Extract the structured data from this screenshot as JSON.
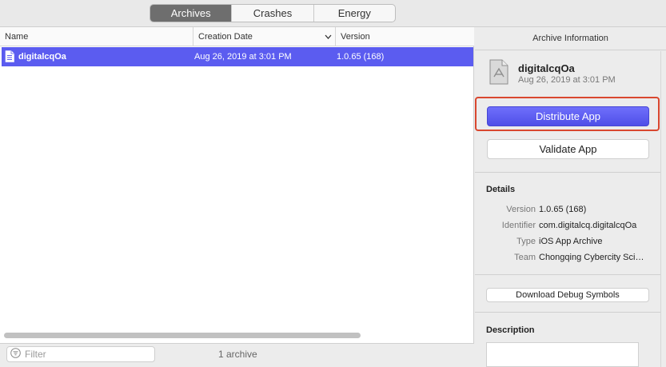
{
  "tabs": [
    {
      "label": "Archives",
      "active": true
    },
    {
      "label": "Crashes",
      "active": false
    },
    {
      "label": "Energy",
      "active": false
    }
  ],
  "table": {
    "columns": [
      "Name",
      "Creation Date",
      "Version"
    ],
    "rows": [
      {
        "name": "digitalcqOa",
        "date": "Aug 26, 2019 at 3:01 PM",
        "version": "1.0.65 (168)"
      }
    ]
  },
  "footer": {
    "filter_placeholder": "Filter",
    "count": "1 archive"
  },
  "panel": {
    "title": "Archive Information",
    "app_name": "digitalcqOa",
    "app_date": "Aug 26, 2019 at 3:01 PM",
    "distribute_label": "Distribute App",
    "validate_label": "Validate App",
    "details_heading": "Details",
    "details": [
      {
        "key": "Version",
        "value": "1.0.65 (168)"
      },
      {
        "key": "Identifier",
        "value": "com.digitalcq.digitalcqOa"
      },
      {
        "key": "Type",
        "value": "iOS App Archive"
      },
      {
        "key": "Team",
        "value": "Chongqing Cybercity Sci…"
      }
    ],
    "debug_label": "Download Debug Symbols",
    "description_heading": "Description"
  },
  "colors": {
    "selection": "#5b5cf0",
    "primary_button": "#5b5cf0",
    "highlight_border": "#d9472f"
  },
  "icons": [
    "filter-icon",
    "archive-file-icon",
    "app-archive-icon",
    "chevron-down-icon"
  ]
}
